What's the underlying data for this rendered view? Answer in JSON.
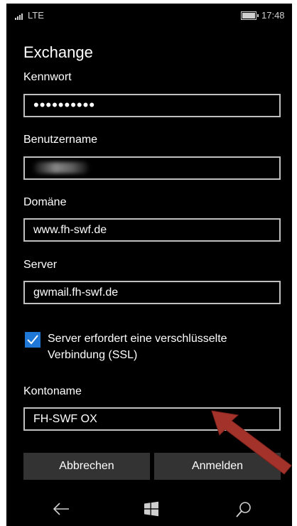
{
  "status_bar": {
    "network": "LTE",
    "time": "17:48"
  },
  "page_title": "Exchange",
  "form": {
    "password": {
      "label": "Kennwort",
      "value": "••••••••••"
    },
    "username": {
      "label": "Benutzername",
      "value": ""
    },
    "domain": {
      "label": "Domäne",
      "value": "www.fh-swf.de"
    },
    "server": {
      "label": "Server",
      "value": "gwmail.fh-swf.de"
    },
    "ssl": {
      "label": "Server erfordert eine verschlüsselte Verbindung (SSL)",
      "checked": true
    },
    "account_name": {
      "label": "Kontoname",
      "value": "FH-SWF OX"
    }
  },
  "buttons": {
    "cancel": "Abbrechen",
    "sign_in": "Anmelden"
  },
  "navbar": {
    "back": "back-icon",
    "home": "windows-icon",
    "search": "search-icon"
  },
  "colors": {
    "accent": "#1f78d8",
    "annotation_arrow": "#a3322b"
  }
}
